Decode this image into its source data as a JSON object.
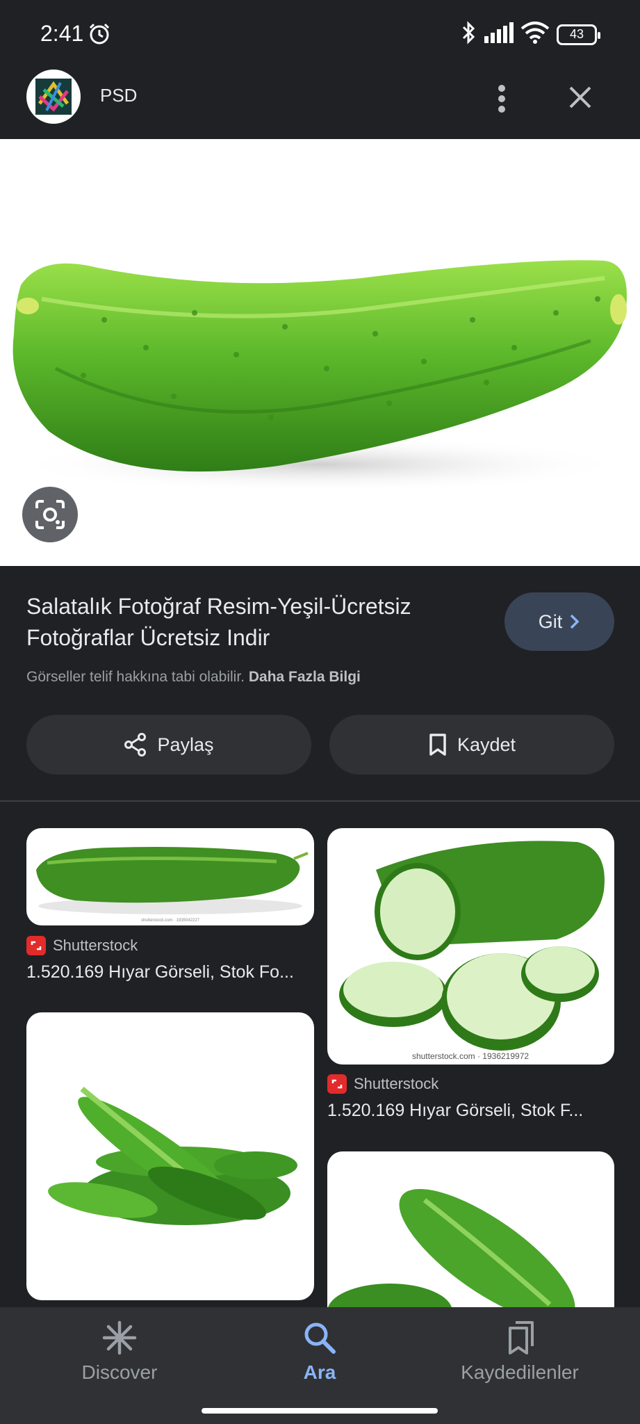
{
  "status_bar": {
    "time": "2:41",
    "battery": "43"
  },
  "header": {
    "site_name": "PSD"
  },
  "result": {
    "title": "Salatalık Fotoğraf Resim-Yeşil-Ücretsiz Fotoğraflar Ücretsiz Indir",
    "visit_label": "Git",
    "copyright_text": "Görseller telif hakkına tabi olabilir.",
    "learn_more": "Daha Fazla Bilgi",
    "share_label": "Paylaş",
    "save_label": "Kaydet"
  },
  "related": [
    {
      "source": "Shutterstock",
      "title": "1.520.169 Hıyar Görseli, Stok Fo...",
      "watermark": "shutterstock.com · 1935042227"
    },
    {
      "source": "Shutterstock",
      "title": "1.520.169 Hıyar Görseli, Stok F...",
      "watermark": "shutterstock.com · 1936219972"
    },
    {
      "source": "",
      "title": ""
    },
    {
      "source": "",
      "title": ""
    }
  ],
  "bottom_nav": {
    "items": [
      {
        "label": "Discover",
        "icon": "asterisk-icon"
      },
      {
        "label": "Ara",
        "icon": "search-icon",
        "active": true
      },
      {
        "label": "Kaydedilenler",
        "icon": "bookmarks-icon"
      }
    ]
  },
  "colors": {
    "accent": "#8ab4f8",
    "background": "#202124",
    "surface": "#303134",
    "source_icon": "#e22b2b"
  }
}
